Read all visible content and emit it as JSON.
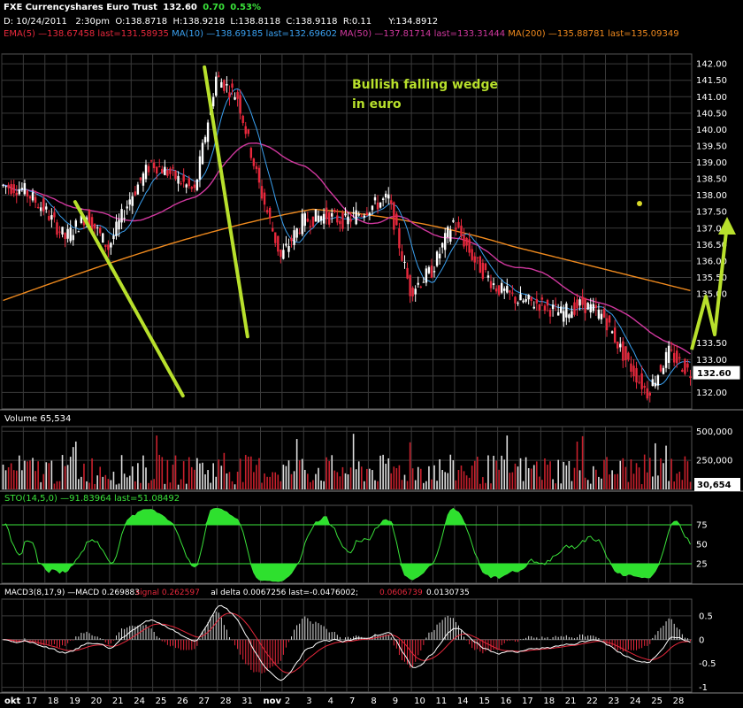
{
  "header": {
    "symbol": "FXE",
    "name": "Currencyshares Euro Trust",
    "last": "132.60",
    "change": "0.70",
    "change_pct": "0.53%",
    "info_line": "D: 10/24/2011   2:30pm  O:138.8718  H:138.9218  L:138.8118  C:138.9118  R:0.11      Y:134.8912",
    "ma_line": [
      {
        "text": "EMA(5) —138.67458 last=131.58935",
        "color": "#e8283c"
      },
      {
        "text": "MA(10) —138.69185 last=132.69602",
        "color": "#3aa0f0"
      },
      {
        "text": "MA(50) —137.81714 last=133.31444",
        "color": "#d0389e"
      },
      {
        "text": "MA(200) —135.88781 last=135.09349",
        "color": "#f08a1e"
      }
    ]
  },
  "annotation": {
    "line1": "Bullish falling wedge",
    "line2": "in euro",
    "color": "#b8e02c"
  },
  "chart_data": [
    {
      "type": "candlestick",
      "panel": "price",
      "ylim": [
        131.5,
        142.3
      ],
      "y_ticks": [
        132.0,
        132.5,
        133.0,
        133.5,
        134.0,
        134.5,
        135.0,
        135.5,
        136.0,
        136.5,
        137.0,
        137.5,
        138.0,
        138.5,
        139.0,
        139.5,
        140.0,
        140.5,
        141.0,
        141.5,
        142.0
      ],
      "y_tick_labels": [
        "132.00",
        "132.50",
        "133.00",
        "133.50",
        "",
        "",
        "135.00",
        "135.50",
        "136.00",
        "136.50",
        "137.00",
        "137.50",
        "138.00",
        "138.50",
        "139.00",
        "139.50",
        "140.00",
        "140.50",
        "141.00",
        "141.50",
        "142.00"
      ],
      "last_price_label": "132.60",
      "x_labels": [
        "okt",
        "17",
        "18",
        "19",
        "20",
        "21",
        "24",
        "25",
        "26",
        "27",
        "28",
        "31",
        "nov",
        "2",
        "3",
        "4",
        "7",
        "8",
        "9",
        "10",
        "11",
        "14",
        "15",
        "16",
        "17",
        "18",
        "21",
        "22",
        "23",
        "24",
        "25",
        "28"
      ],
      "closes_approx": [
        138.2,
        137.6,
        136.7,
        137.4,
        136.4,
        137.9,
        139.0,
        138.6,
        138.1,
        141.6,
        141.0,
        138.3,
        136.1,
        137.2,
        137.4,
        137.2,
        137.6,
        137.9,
        135.1,
        135.7,
        137.2,
        136.0,
        135.2,
        134.8,
        134.7,
        134.4,
        134.7,
        134.3,
        133.0,
        132.0,
        133.2,
        132.6
      ],
      "series": [
        {
          "name": "EMA(5)",
          "color": "#e8283c"
        },
        {
          "name": "MA(10)",
          "color": "#3aa0f0"
        },
        {
          "name": "MA(50)",
          "color": "#d0389e"
        },
        {
          "name": "MA(200)",
          "color": "#f08a1e"
        }
      ],
      "wedge_upper": {
        "from": [
          "27",
          141.9
        ],
        "to": [
          "28",
          133.7
        ]
      },
      "wedge_lower": {
        "from": [
          "19",
          137.8
        ],
        "to": [
          "25",
          131.9
        ]
      }
    },
    {
      "type": "bar",
      "panel": "volume",
      "title": "Volume 65,534",
      "y_tick_labels": [
        "500,000",
        "250,000"
      ],
      "last_label": "30,654",
      "ylim": [
        0,
        540000
      ]
    },
    {
      "type": "line",
      "panel": "stochastic",
      "title": "STO(14,5,0) —91.83964 last=51.08492",
      "y_ticks": [
        25,
        50,
        75
      ],
      "y_tick_labels": [
        "25",
        "50",
        "75"
      ],
      "ylim": [
        0,
        100
      ],
      "levels": [
        25,
        75
      ]
    },
    {
      "type": "line",
      "panel": "macd",
      "title_parts": [
        {
          "text": "MACD3(8,17,9) —MACD 0.269883",
          "color": "#ffffff"
        },
        {
          "text": " signal 0.262597",
          "color": "#e8283c"
        },
        {
          "text": " al delta 0.0067256 last=-0.0476002;",
          "color": "#ffffff"
        },
        {
          "text": " 0.0606739",
          "color": "#e8283c"
        },
        {
          "text": " 0.0130735",
          "color": "#ffffff"
        }
      ],
      "y_ticks": [
        0.5,
        0,
        -0.5,
        -1
      ],
      "y_tick_labels": [
        "0.5",
        "0",
        "-0.5",
        "-1"
      ],
      "ylim": [
        -1.1,
        0.85
      ]
    }
  ]
}
